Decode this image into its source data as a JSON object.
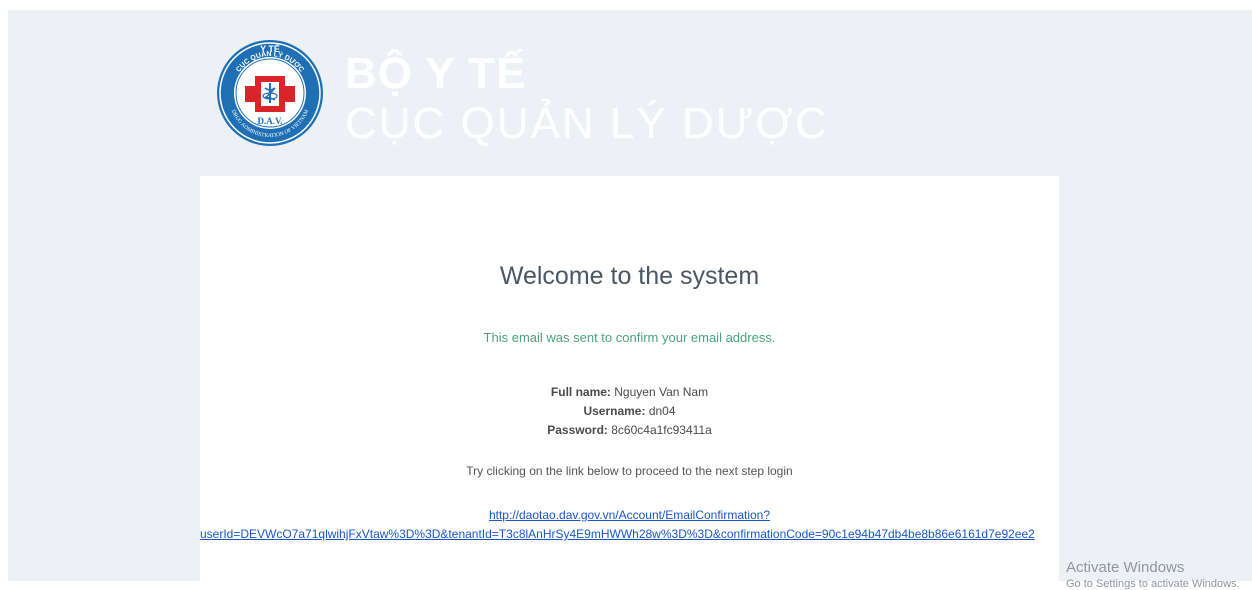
{
  "header": {
    "logo_text": {
      "top": "Y TẾ",
      "ring": "CỤC QUẢN LÝ DƯỢC",
      "bottom_ring": "DRUG ADMINISTRATION OF VIETNAM",
      "initials": "D.A.V."
    },
    "brand_line1": "BỘ Y TẾ",
    "brand_line2": "CỤC QUẢN LÝ DƯỢC"
  },
  "email": {
    "title": "Welcome to the system",
    "confirm_text": "This email was sent to confirm your email address.",
    "full_name_label": "Full name:",
    "full_name_value": "Nguyen Van Nam",
    "username_label": "Username:",
    "username_value": "dn04",
    "password_label": "Password:",
    "password_value": "8c60c4a1fc93411a",
    "instruction": "Try clicking on the link below to proceed to the next step login",
    "link_line1": "http://daotao.dav.gov.vn/Account/EmailConfirmation?",
    "link_line2": "userId=DEVWcO7a71qlwihjFxVtaw%3D%3D&tenantId=T3c8lAnHrSy4E9mHWWh28w%3D%3D&confirmationCode=90c1e94b47db4be8b86e6161d7e92ee2"
  },
  "watermark": {
    "title": "Activate Windows",
    "subtitle": "Go to Settings to activate Windows."
  },
  "colors": {
    "background": "#edf1f5",
    "card": "#ffffff",
    "title": "#4a5866",
    "confirm": "#4aa37e",
    "link": "#1a56c9",
    "logo_blue": "#1f6fb5",
    "logo_red": "#d9252a"
  }
}
